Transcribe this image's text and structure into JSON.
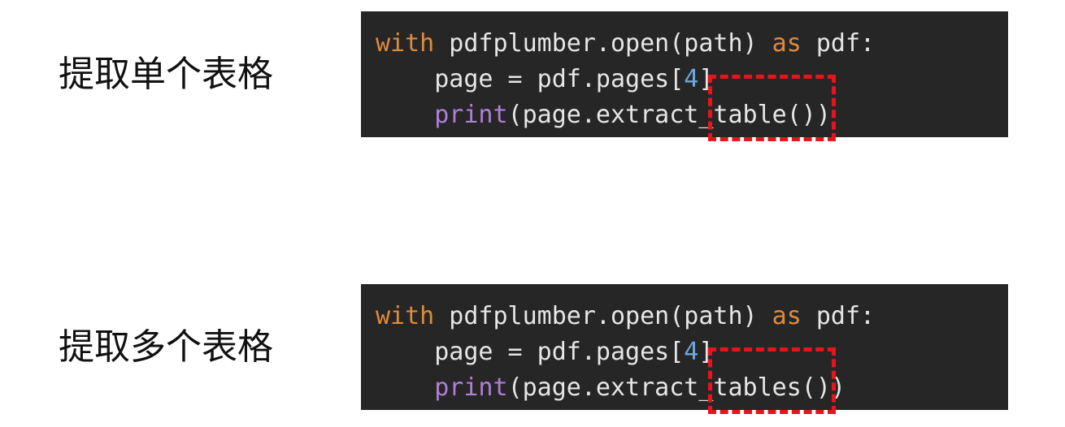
{
  "colors": {
    "keyword": "#e08a3c",
    "number": "#6fa8dc",
    "function": "#b07fd8",
    "plain": "#e6e6e6",
    "highlight": "#e8141c",
    "code_bg": "#262626"
  },
  "sections": [
    {
      "label": "提取单个表格",
      "lines": [
        {
          "kw1": "with",
          "a": " pdfplumber.open(path) ",
          "kw2": "as",
          "b": " pdf:"
        },
        {
          "a": "    page = pdf.pages[",
          "num": "4",
          "b": "]"
        },
        {
          "fn": "print",
          "a": "(page.extract_",
          "hl": "table())"
        }
      ]
    },
    {
      "label": "提取多个表格",
      "lines": [
        {
          "kw1": "with",
          "a": " pdfplumber.open(path) ",
          "kw2": "as",
          "b": " pdf:"
        },
        {
          "a": "    page = pdf.pages[",
          "num": "4",
          "b": "]"
        },
        {
          "fn": "print",
          "a": "(page.extract_",
          "hl": "tables()",
          "c": ")"
        }
      ]
    }
  ]
}
